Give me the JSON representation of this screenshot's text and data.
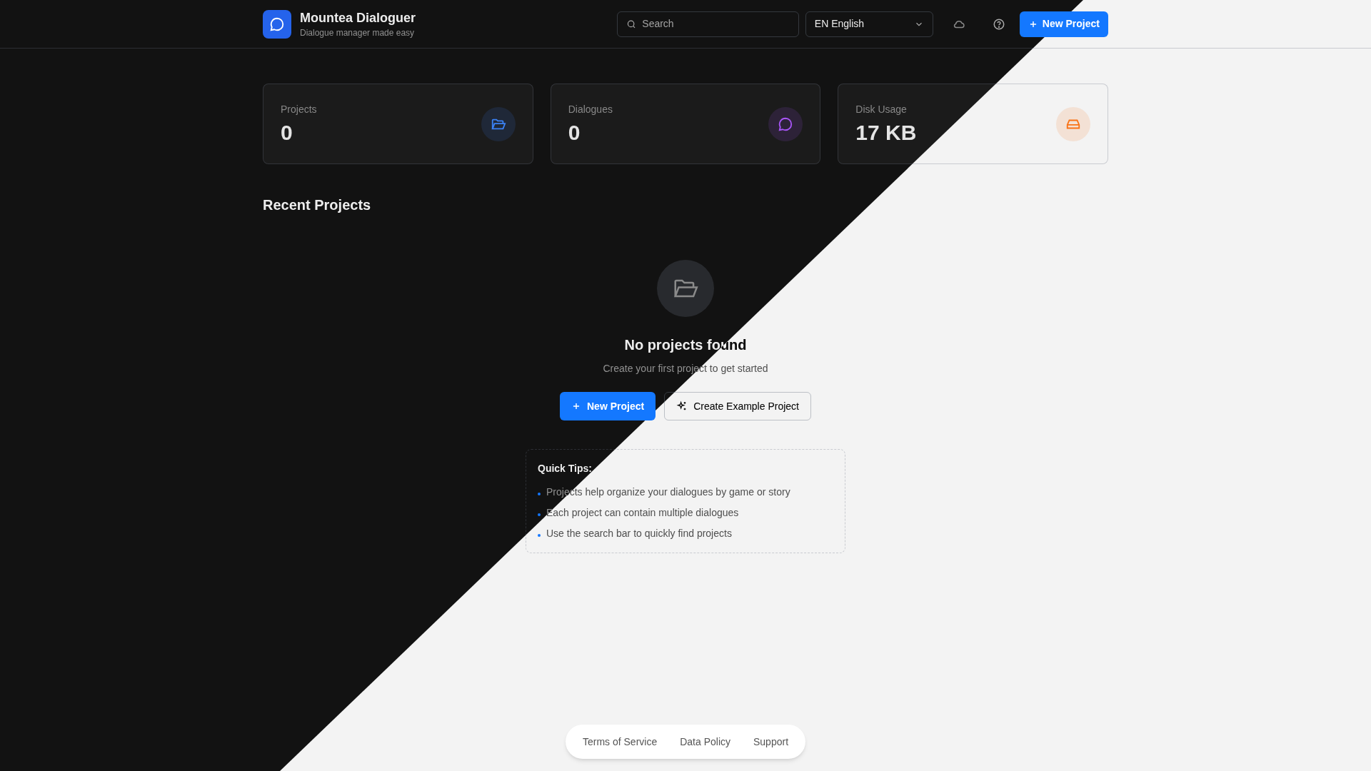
{
  "header": {
    "title": "Mountea Dialoguer",
    "tagline": "Dialogue manager made easy",
    "search": {
      "placeholder": "Search"
    },
    "language": "EN English",
    "new_project": "New Project"
  },
  "stats": [
    {
      "label": "Projects",
      "value": "0",
      "kind": "folder",
      "color": "#3b82f6"
    },
    {
      "label": "Dialogues",
      "value": "0",
      "kind": "chat",
      "color": "#a855f7"
    },
    {
      "label": "Disk Usage",
      "value": "17 KB",
      "kind": "drive",
      "color": "#f97316"
    }
  ],
  "recent": {
    "title": "Recent Projects",
    "empty_title": "No projects found",
    "empty_text": "Create your first project to get started",
    "new_project": "New Project",
    "example_project": "Create Example Project"
  },
  "tips": {
    "title": "Quick Tips:",
    "items": [
      "Projects help organize your dialogues by game or story",
      "Each project can contain multiple dialogues",
      "Use the search bar to quickly find projects"
    ]
  },
  "footer": [
    "Terms of Service",
    "Data Policy",
    "Support"
  ]
}
